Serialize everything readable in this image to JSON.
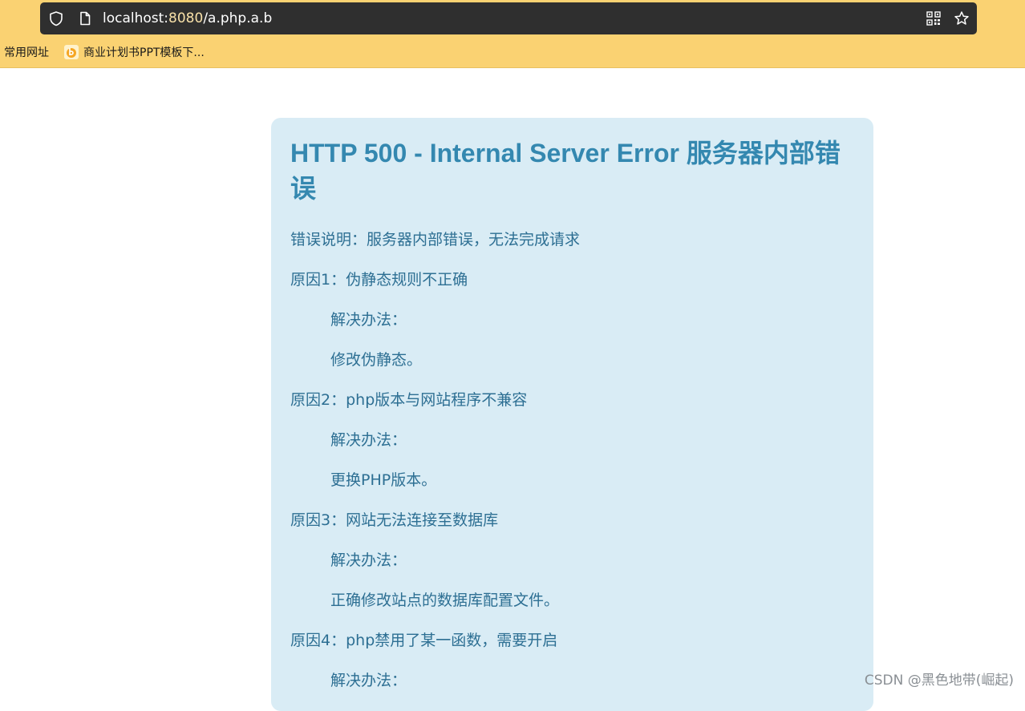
{
  "browser": {
    "url_host": "localhost:",
    "url_port": "8080",
    "url_path": "/a.php.a.b",
    "bookmarks": [
      {
        "label": "常用网址"
      },
      {
        "label": "商业计划书PPT模板下..."
      }
    ]
  },
  "page": {
    "title": "HTTP 500 - Internal Server Error 服务器内部错误",
    "lines": [
      {
        "text": "错误说明：服务器内部错误，无法完成请求",
        "indent": false
      },
      {
        "text": "原因1：伪静态规则不正确",
        "indent": false
      },
      {
        "text": "解决办法：",
        "indent": true
      },
      {
        "text": "修改伪静态。",
        "indent": true
      },
      {
        "text": "原因2：php版本与网站程序不兼容",
        "indent": false
      },
      {
        "text": "解决办法：",
        "indent": true
      },
      {
        "text": "更换PHP版本。",
        "indent": true
      },
      {
        "text": "原因3：网站无法连接至数据库",
        "indent": false
      },
      {
        "text": "解决办法：",
        "indent": true
      },
      {
        "text": "正确修改站点的数据库配置文件。",
        "indent": true
      },
      {
        "text": "原因4：php禁用了某一函数，需要开启",
        "indent": false
      },
      {
        "text": "解决办法：",
        "indent": true
      }
    ]
  },
  "watermark": "CSDN @黑色地带(崛起)",
  "colors": {
    "toolbar": "#fad272",
    "address_bar": "#2f2f2f",
    "card_bg": "#d9ecf5",
    "title": "#3488b0",
    "text": "#2d6f93"
  },
  "icons": [
    "shield-icon",
    "page-icon",
    "qr-code-icon",
    "star-icon",
    "bookmark-favicon"
  ]
}
